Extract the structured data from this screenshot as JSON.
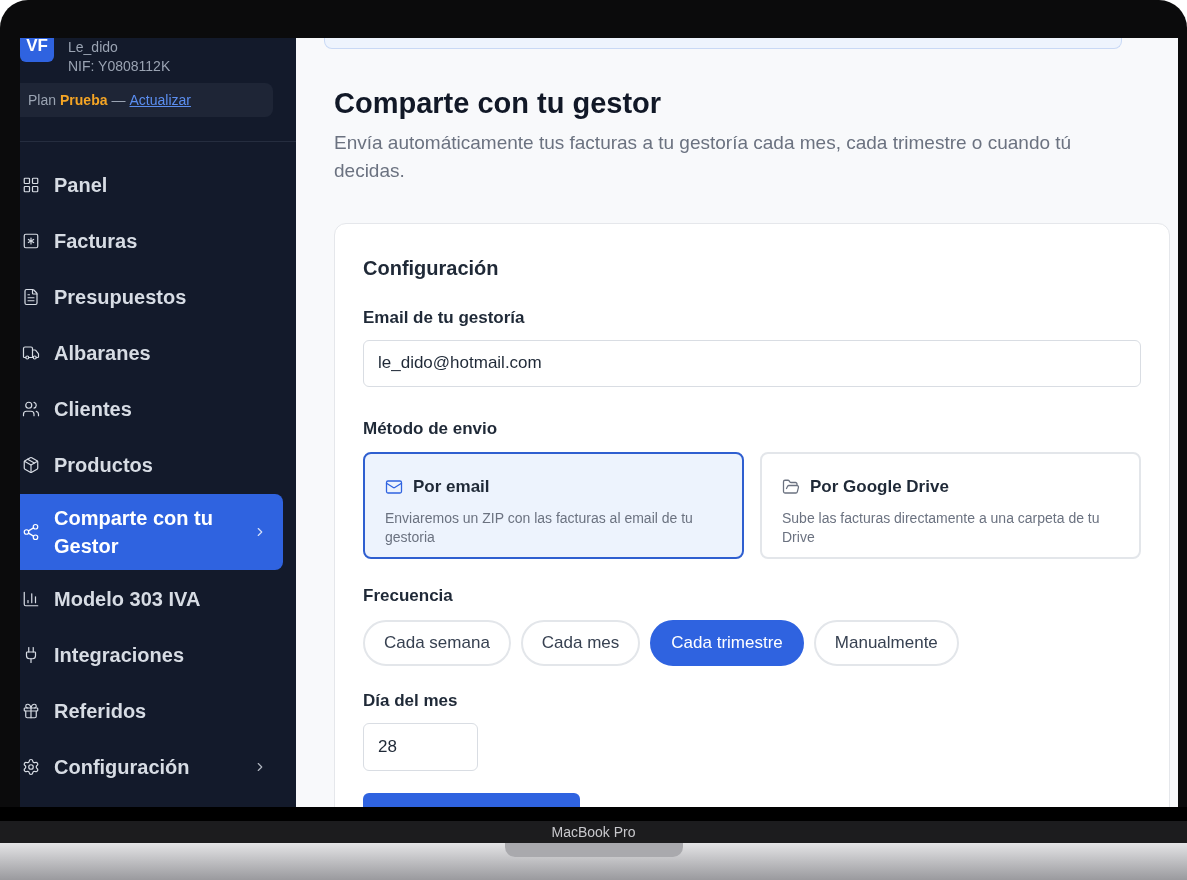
{
  "account": {
    "initials": "VF",
    "name": "Le_dido",
    "nif": "NIF: Y0808112K"
  },
  "plan": {
    "label": "Plan",
    "name": "Prueba",
    "separator": "—",
    "link": "Actualizar"
  },
  "sidebar": {
    "items": [
      {
        "label": "Panel",
        "selected": false,
        "has_submenu": false
      },
      {
        "label": "Facturas",
        "selected": false,
        "has_submenu": false
      },
      {
        "label": "Presupuestos",
        "selected": false,
        "has_submenu": false
      },
      {
        "label": "Albaranes",
        "selected": false,
        "has_submenu": false
      },
      {
        "label": "Clientes",
        "selected": false,
        "has_submenu": false
      },
      {
        "label": "Productos",
        "selected": false,
        "has_submenu": false
      },
      {
        "label": "Comparte con tu Gestor",
        "selected": true,
        "has_submenu": true
      },
      {
        "label": "Modelo 303 IVA",
        "selected": false,
        "has_submenu": false
      },
      {
        "label": "Integraciones",
        "selected": false,
        "has_submenu": false
      },
      {
        "label": "Referidos",
        "selected": false,
        "has_submenu": false
      },
      {
        "label": "Configuración",
        "selected": false,
        "has_submenu": true
      }
    ]
  },
  "page": {
    "title": "Comparte con tu gestor",
    "subtitle": "Envía automáticamente tus facturas a tu gestoría cada mes, cada trimestre o cuando tú decidas."
  },
  "config": {
    "heading": "Configuración",
    "email": {
      "label": "Email de tu gestoría",
      "value": "le_dido@hotmail.com"
    },
    "method": {
      "label": "Método de envio",
      "options": [
        {
          "title": "Por email",
          "description": "Enviaremos un ZIP con las facturas al email de tu gestoria",
          "selected": true
        },
        {
          "title": "Por Google Drive",
          "description": "Sube las facturas directamente a una carpeta de tu Drive",
          "selected": false
        }
      ]
    },
    "frequency": {
      "label": "Frecuencia",
      "options": [
        {
          "label": "Cada semana",
          "selected": false
        },
        {
          "label": "Cada mes",
          "selected": false
        },
        {
          "label": "Cada trimestre",
          "selected": true
        },
        {
          "label": "Manualmente",
          "selected": false
        }
      ]
    },
    "day": {
      "label": "Día del mes",
      "value": "28"
    }
  },
  "device": {
    "label": "MacBook Pro"
  }
}
